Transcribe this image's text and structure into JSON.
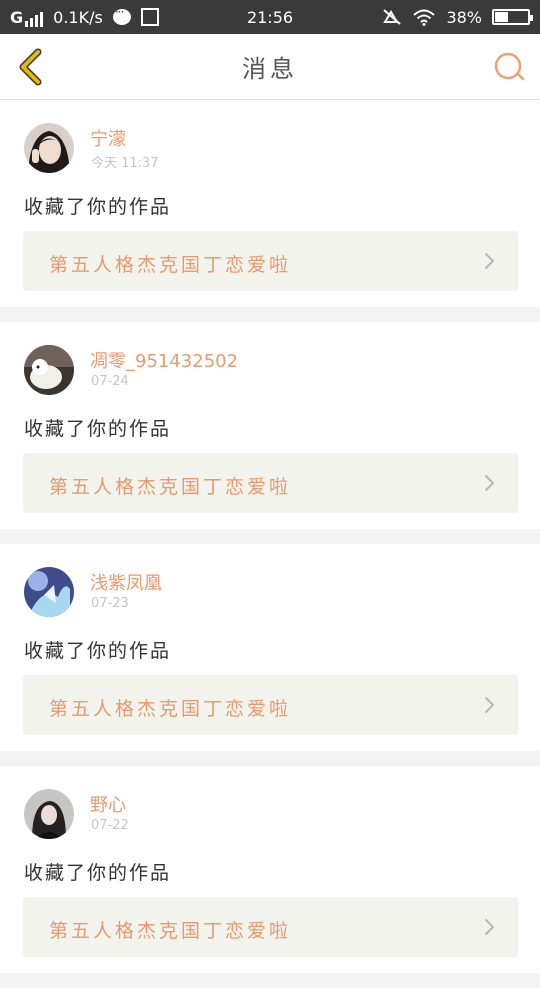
{
  "status_bar": {
    "carrier": "G",
    "speed": "0.1K/s",
    "time": "21:56",
    "battery": "38%",
    "battery_level": 0.38,
    "icons": [
      "signal-icon",
      "chat-icon",
      "screenshot-icon",
      "mute-icon",
      "wifi-icon",
      "battery-icon"
    ]
  },
  "header": {
    "title": "消息",
    "back_icon": "chevron-left-icon",
    "search_icon": "search-icon"
  },
  "colors": {
    "accent": "#e79a6d",
    "back_icon": "#e6b800",
    "status_bar": "#3a3a3a",
    "link_bg": "#f3f3ee"
  },
  "messages": [
    {
      "username": "宁濛",
      "time": "今天 11:37",
      "action": "收藏了你的作品",
      "work_title": "第五人格杰克国丁恋爱啦",
      "avatar": "avatar-1"
    },
    {
      "username": "凋零_951432502",
      "time": "07-24",
      "action": "收藏了你的作品",
      "work_title": "第五人格杰克国丁恋爱啦",
      "avatar": "avatar-2"
    },
    {
      "username": "浅紫凤凰",
      "time": "07-23",
      "action": "收藏了你的作品",
      "work_title": "第五人格杰克国丁恋爱啦",
      "avatar": "avatar-3"
    },
    {
      "username": "野心",
      "time": "07-22",
      "action": "收藏了你的作品",
      "work_title": "第五人格杰克国丁恋爱啦",
      "avatar": "avatar-4"
    }
  ]
}
